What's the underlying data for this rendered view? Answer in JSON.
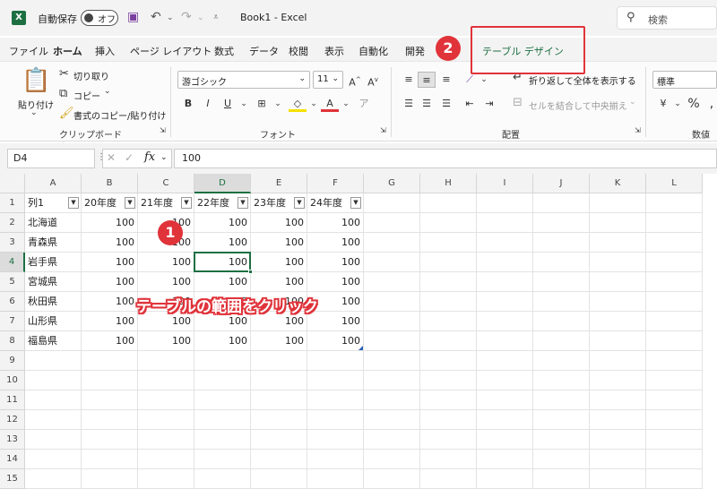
{
  "titlebar": {
    "autosave_label": "自動保存",
    "autosave_state": "オフ",
    "document_title": "Book1  -  Excel",
    "search_placeholder": "検索"
  },
  "tabs": [
    "ファイル",
    "ホーム",
    "挿入",
    "ページ レイアウト",
    "数式",
    "データ",
    "校閲",
    "表示",
    "自動化",
    "開発",
    "テーブル デザイン"
  ],
  "active_tab": "ホーム",
  "ribbon": {
    "clipboard": {
      "paste": "貼り付け",
      "cut": "切り取り",
      "copy": "コピー",
      "format_painter": "書式のコピー/貼り付け",
      "label": "クリップボード"
    },
    "font": {
      "name": "游ゴシック",
      "size": "11",
      "label": "フォント"
    },
    "alignment": {
      "wrap": "折り返して全体を表示する",
      "merge": "セルを結合して中央揃え",
      "label": "配置"
    },
    "number": {
      "format": "標準",
      "label": "数値"
    }
  },
  "formula_bar": {
    "name_box": "D4",
    "formula": "100"
  },
  "columns": [
    "A",
    "B",
    "C",
    "D",
    "E",
    "F",
    "G",
    "H",
    "I",
    "J",
    "K",
    "L"
  ],
  "rows": [
    "1",
    "2",
    "3",
    "4",
    "5",
    "6",
    "7",
    "8",
    "9",
    "10",
    "11",
    "12",
    "13",
    "14",
    "15"
  ],
  "table": {
    "headers": [
      "列1",
      "20年度",
      "21年度",
      "22年度",
      "23年度",
      "24年度"
    ],
    "body": [
      [
        "北海道",
        "100",
        "100",
        "100",
        "100",
        "100"
      ],
      [
        "青森県",
        "100",
        "100",
        "100",
        "100",
        "100"
      ],
      [
        "岩手県",
        "100",
        "100",
        "100",
        "100",
        "100"
      ],
      [
        "宮城県",
        "100",
        "100",
        "100",
        "100",
        "100"
      ],
      [
        "秋田県",
        "100",
        "100",
        "100",
        "100",
        "100"
      ],
      [
        "山形県",
        "100",
        "100",
        "100",
        "100",
        "100"
      ],
      [
        "福島県",
        "100",
        "100",
        "100",
        "100",
        "100"
      ]
    ]
  },
  "annotations": {
    "badge1": "1",
    "badge2": "2",
    "instruction": "テーブルの範囲をクリック"
  },
  "colors": {
    "excel_green": "#1d6f42",
    "annotation_red": "#e0333a"
  }
}
